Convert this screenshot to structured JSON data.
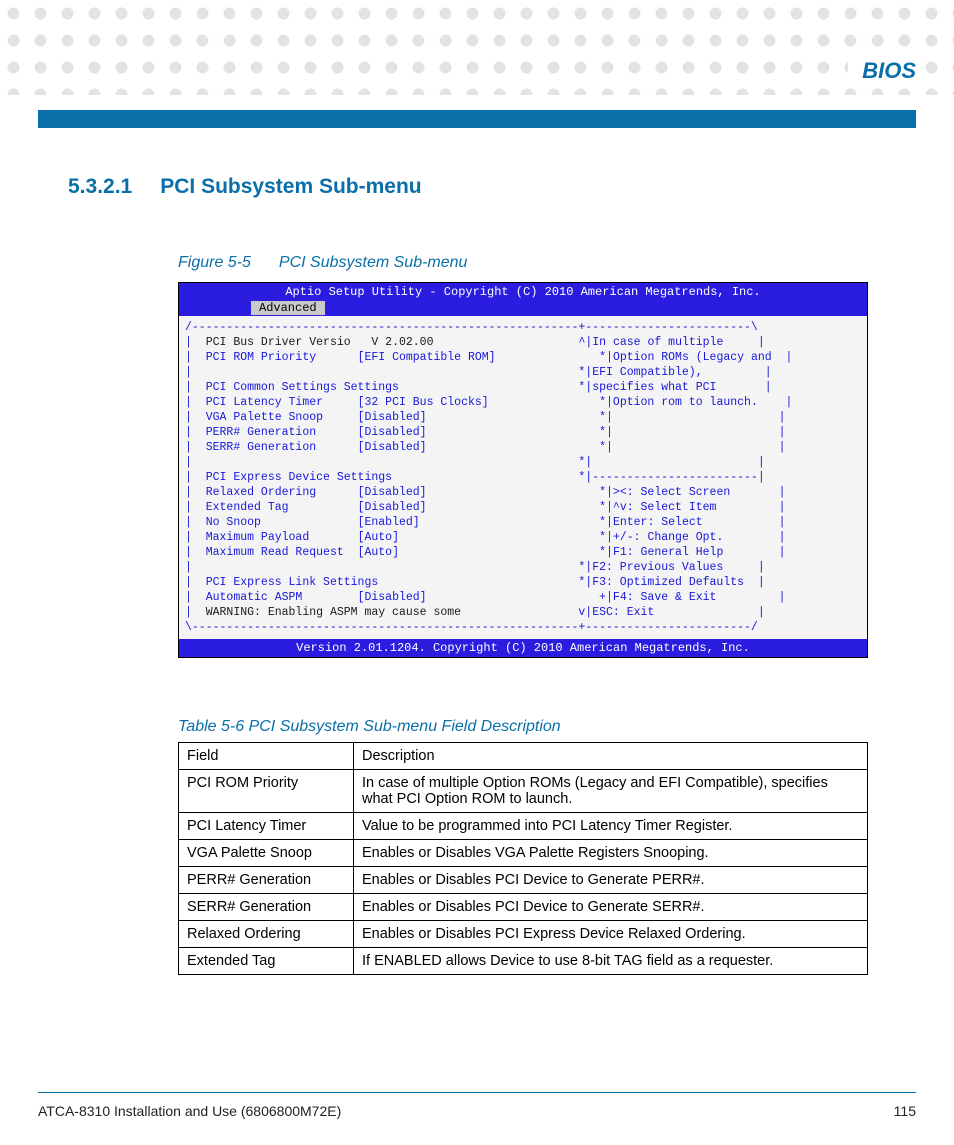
{
  "chapter": "BIOS",
  "section": {
    "number": "5.3.2.1",
    "title": "PCI Subsystem Sub-menu"
  },
  "figure": {
    "label": "Figure 5-5",
    "title": "PCI Subsystem Sub-menu"
  },
  "bios": {
    "header": "Aptio Setup Utility - Copyright (C) 2010 American Megatrends, Inc.",
    "tab": "Advanced",
    "footer": "Version 2.01.1204. Copyright (C) 2010 American Megatrends, Inc.",
    "left": {
      "version_label": "PCI Bus Driver Versio",
      "version_value": "V 2.02.00",
      "rom_priority_label": "PCI ROM Priority",
      "rom_priority_value": "[EFI Compatible ROM]",
      "common_header": "PCI Common Settings Settings",
      "latency_label": "PCI Latency Timer",
      "latency_value": "[32 PCI Bus Clocks]",
      "vga_label": "VGA Palette Snoop",
      "vga_value": "[Disabled]",
      "perr_label": "PERR# Generation",
      "perr_value": "[Disabled]",
      "serr_label": "SERR# Generation",
      "serr_value": "[Disabled]",
      "express_header": "PCI Express Device Settings",
      "relaxed_label": "Relaxed Ordering",
      "relaxed_value": "[Disabled]",
      "ext_label": "Extended Tag",
      "ext_value": "[Disabled]",
      "nosnoop_label": "No Snoop",
      "nosnoop_value": "[Enabled]",
      "payload_label": "Maximum Payload",
      "payload_value": "[Auto]",
      "readreq_label": "Maximum Read Request",
      "readreq_value": "[Auto]",
      "link_header": "PCI Express Link Settings",
      "aspm_label": "Automatic ASPM",
      "aspm_value": "[Disabled]",
      "warn": "WARNING: Enabling ASPM may cause some"
    },
    "help": {
      "l1": "In case of multiple",
      "l2": "Option ROMs (Legacy and",
      "l3": "EFI Compatible),",
      "l4": "specifies what PCI",
      "l5": "Option rom to launch.",
      "nav1": "><: Select Screen",
      "nav2": "^v: Select Item",
      "nav3": "Enter: Select",
      "nav4": "+/-: Change Opt.",
      "nav5": "F1: General Help",
      "nav6": "F2: Previous Values",
      "nav7": "F3: Optimized Defaults",
      "nav8": "F4: Save & Exit",
      "nav9": "ESC: Exit"
    }
  },
  "table": {
    "caption": "Table 5-6 PCI Subsystem Sub-menu Field Description",
    "h1": "Field",
    "h2": "Description",
    "rows": [
      {
        "f": "PCI ROM Priority",
        "d": "In case of multiple Option ROMs (Legacy and EFI Compatible), specifies what PCI Option ROM to launch."
      },
      {
        "f": "PCI Latency Timer",
        "d": "Value to be programmed into PCI Latency Timer Register."
      },
      {
        "f": "VGA Palette Snoop",
        "d": "Enables or Disables VGA Palette Registers Snooping."
      },
      {
        "f": "PERR# Generation",
        "d": "Enables or Disables PCI Device to Generate PERR#."
      },
      {
        "f": "SERR# Generation",
        "d": "Enables or Disables PCI Device to Generate SERR#."
      },
      {
        "f": "Relaxed Ordering",
        "d": "Enables or Disables PCI Express Device Relaxed Ordering."
      },
      {
        "f": "Extended Tag",
        "d": "If ENABLED allows Device to use 8-bit TAG field as a requester."
      }
    ]
  },
  "footer": {
    "doc": "ATCA-8310 Installation and Use (6806800M72E)",
    "page": "115"
  }
}
